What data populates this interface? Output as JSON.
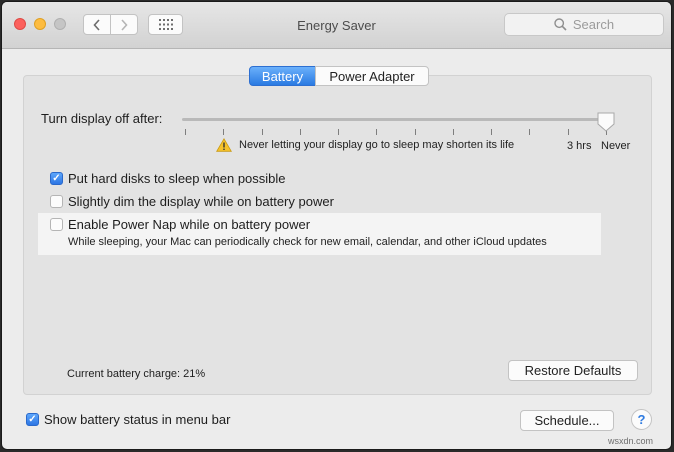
{
  "window": {
    "title": "Energy Saver"
  },
  "toolbar": {
    "search_placeholder": "Search",
    "back_icon": "chevron-left-icon",
    "forward_icon": "chevron-right-icon",
    "grid_icon": "grid-icon"
  },
  "tabs": [
    {
      "label": "Battery",
      "selected": true
    },
    {
      "label": "Power Adapter",
      "selected": false
    }
  ],
  "display_sleep": {
    "label": "Turn display off after:",
    "warning": "Never letting your display go to sleep may shorten its life",
    "tick_labels": [
      "3 hrs",
      "Never"
    ],
    "value": "Never"
  },
  "options": [
    {
      "label": "Put hard disks to sleep when possible",
      "checked": true
    },
    {
      "label": "Slightly dim the display while on battery power",
      "checked": false
    },
    {
      "label": "Enable Power Nap while on battery power",
      "checked": false,
      "description": "While sleeping, your Mac can periodically check for new email, calendar, and other iCloud updates"
    }
  ],
  "battery": {
    "charge_text": "Current battery charge: 21%"
  },
  "buttons": {
    "restore_defaults": "Restore Defaults",
    "schedule": "Schedule...",
    "help": "?"
  },
  "footer": {
    "show_status_label": "Show battery status in menu bar",
    "show_status_checked": true
  },
  "watermark": "wsxdn.com",
  "colors": {
    "accent": "#2a7ae2",
    "close": "#fc605c",
    "minimize": "#fdbc40",
    "warning": "#f5c22c"
  }
}
